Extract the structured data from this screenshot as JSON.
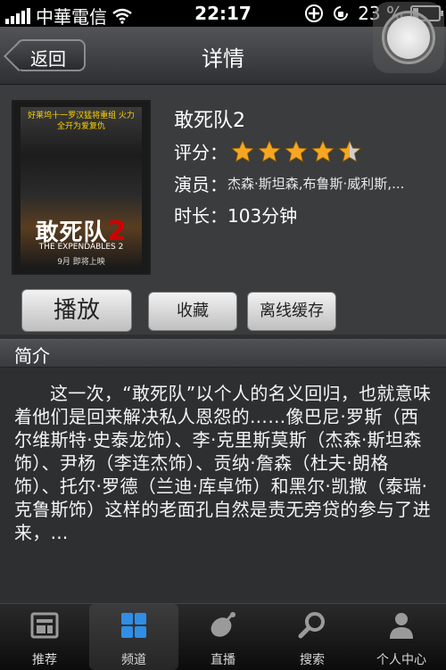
{
  "status_bar": {
    "carrier": "中華電信",
    "time": "22:17",
    "battery": "23 %",
    "battery_level": 0.23
  },
  "nav": {
    "back_label": "返回",
    "title": "详情"
  },
  "movie": {
    "title": "敢死队2",
    "rating_label": "评分：",
    "rating_value": 4.5,
    "rating_max": 5,
    "actors_label": "演员：",
    "actors": "杰森·斯坦森,布鲁斯·威利斯,...",
    "duration_label": "时长：",
    "duration": "103分钟",
    "poster": {
      "tagline": "好莱坞十一罗汉猛将重组 火力全开为爱复仇",
      "title_cn": "敢死队",
      "title_num": "2",
      "title_en": "THE EXPENDABLES 2",
      "release": "9月   即将上映"
    }
  },
  "actions": {
    "play": "播放",
    "favorite": "收藏",
    "offline_cache": "离线缓存"
  },
  "intro": {
    "heading": "简介",
    "text": "这一次，“敢死队”以个人的名义回归，也就意味着他们是回来解决私人恩怨的……像巴尼·罗斯（西尔维斯特·史泰龙饰）、李·克里斯莫斯（杰森·斯坦森饰）、尹杨（李连杰饰）、贡纳·詹森（杜夫·朗格饰）、托尔·罗德（兰迪·库卓饰）和黑尔·凯撒（泰瑞·克鲁斯饰）这样的老面孔自然是责无旁贷的参与了进来，..."
  },
  "tabs": [
    {
      "label": "推荐",
      "icon": "recommend-icon"
    },
    {
      "label": "频道",
      "icon": "channel-grid-icon"
    },
    {
      "label": "直播",
      "icon": "live-satellite-icon"
    },
    {
      "label": "搜索",
      "icon": "search-icon"
    },
    {
      "label": "个人中心",
      "icon": "user-icon"
    }
  ],
  "active_tab": 1,
  "colors": {
    "star": "#f5a623",
    "tab_active_icon": "#2f8ee6"
  }
}
